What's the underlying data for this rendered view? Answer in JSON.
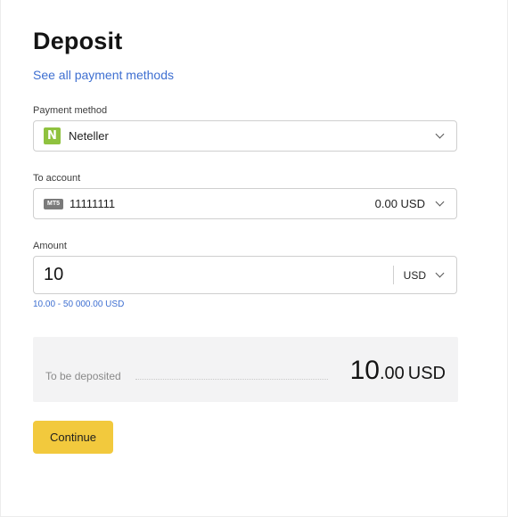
{
  "header": {
    "title": "Deposit",
    "see_all_link": "See all payment methods"
  },
  "payment_method": {
    "label": "Payment method",
    "logo_letter": "N",
    "logo_icon": "neteller-logo-icon",
    "value": "Neteller",
    "dropdown_icon": "chevron-down-icon"
  },
  "to_account": {
    "label": "To account",
    "platform_badge": "MT5",
    "account_number": "11111111",
    "balance": "0.00 USD",
    "dropdown_icon": "chevron-down-icon"
  },
  "amount": {
    "label": "Amount",
    "value": "10",
    "currency": "USD",
    "range_hint": "10.00 - 50 000.00 USD"
  },
  "summary": {
    "label": "To be deposited",
    "amount_integer": "10",
    "amount_decimal": ".00",
    "currency": "USD"
  },
  "actions": {
    "continue_label": "Continue"
  },
  "colors": {
    "accent_link": "#3e6fd1",
    "button_yellow": "#f2c93d",
    "neteller_green": "#8fc23f",
    "summary_bg": "#f3f3f4"
  }
}
